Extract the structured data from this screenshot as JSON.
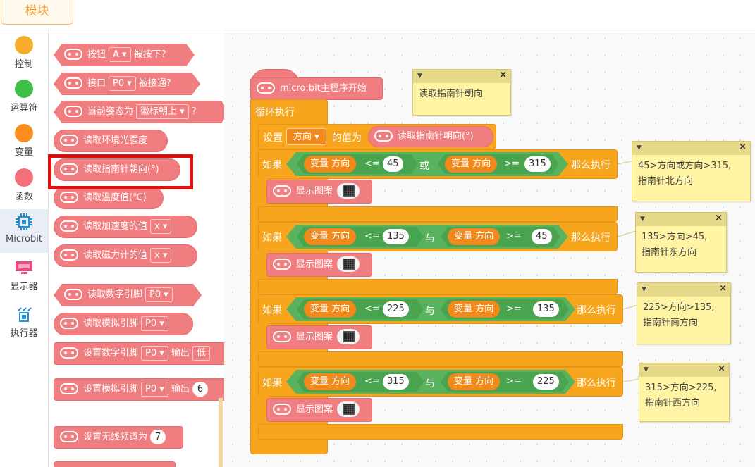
{
  "top_tab": "模块",
  "categories": [
    {
      "label": "控制",
      "color": "#f8ac2b"
    },
    {
      "label": "运算符",
      "color": "#3fbf46"
    },
    {
      "label": "变量",
      "color": "#fb8d1e"
    },
    {
      "label": "函数",
      "color": "#f56f7a"
    },
    {
      "label": "Microbit",
      "color": "#1f92d6"
    },
    {
      "label": "显示器",
      "color": "#e94a84"
    },
    {
      "label": "执行器",
      "color": "#1f92d6"
    }
  ],
  "palette": {
    "btn_pressed": {
      "a": "按钮",
      "dd": "A",
      "b": "被按下?"
    },
    "pin_connected": {
      "a": "接口",
      "dd": "P0",
      "b": "被接通?"
    },
    "gesture": {
      "a": "当前姿态为",
      "dd": "徽标朝上",
      "b": "?"
    },
    "light": "读取环境光强度",
    "compass": "读取指南针朝向(°)",
    "temp": "读取温度值(℃)",
    "accel": {
      "a": "读取加速度的值",
      "dd": "x"
    },
    "mag": {
      "a": "读取磁力计的值",
      "dd": "x"
    },
    "digital_read": {
      "a": "读取数字引脚",
      "dd": "P0"
    },
    "analog_read": {
      "a": "读取模拟引脚",
      "dd": "P0"
    },
    "digital_write": {
      "a": "设置数字引脚",
      "dd": "P0",
      "b": "输出",
      "c": "低"
    },
    "analog_write": {
      "a": "设置模拟引脚",
      "dd": "P0",
      "b": "输出",
      "c": "6"
    },
    "radio": {
      "a": "设置无线频道为",
      "num": "7"
    }
  },
  "script": {
    "hat": "micro:bit主程序开始",
    "loop": "循环执行",
    "set": {
      "a": "设置",
      "var": "方向",
      "b": "的值为",
      "reporter": "读取指南针朝向(°)"
    },
    "if_kw": "如果",
    "then_kw": "那么执行",
    "var_label": "变量 方向",
    "show_image": "显示图案",
    "conds": [
      {
        "op1": "<=",
        "n1": "45",
        "logic": "或",
        "op2": ">=",
        "n2": "315"
      },
      {
        "op1": "<=",
        "n1": "135",
        "logic": "与",
        "op2": ">=",
        "n2": "45"
      },
      {
        "op1": "<=",
        "n1": "225",
        "logic": "与",
        "op2": ">=",
        "n2": "135"
      },
      {
        "op1": "<=",
        "n1": "315",
        "logic": "与",
        "op2": ">=",
        "n2": "225"
      }
    ]
  },
  "notes": [
    "读取指南针朝向",
    "45>方向或方向>315,\n指南针北方向",
    "135>方向>45,\n指南针东方向",
    "225>方向>135,\n指南针南方向",
    "315>方向>225,\n指南针西方向"
  ]
}
